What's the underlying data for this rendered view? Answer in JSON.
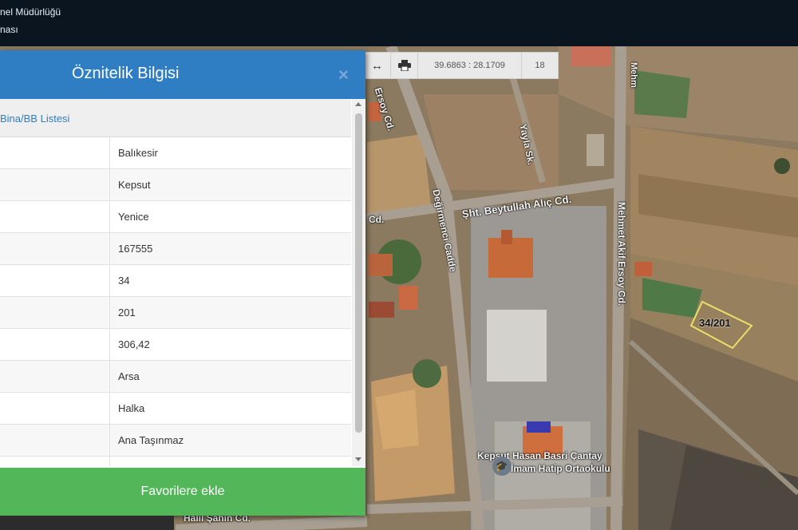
{
  "header": {
    "line1": "nel Müdürlüğü",
    "line2": "nası"
  },
  "toolbar": {
    "measure_icon": "arrows-horizontal-icon",
    "print_icon": "printer-icon",
    "coordinates": "39.6863 : 28.1709",
    "zoom_level": "18"
  },
  "map": {
    "street_labels": [
      "Ersoy Cd.",
      "Yayla Sk.",
      "Şht. Beytullah Alıç Cd.",
      "Değirmenci Cadde",
      "Mehmet Akif Ersoy Cd.",
      "Cd.",
      "Halil Şahin Cd.",
      "Kepsut Hasan Basri Çantay",
      "İmam Hatip Ortaokulu",
      "Mehm"
    ],
    "parcel_label": "34/201"
  },
  "panel": {
    "title": "Öznitelik Bilgisi",
    "close_symbol": "×",
    "section": "Bina/BB Listesi",
    "rows": [
      {
        "value": "Balıkesir"
      },
      {
        "value": "Kepsut"
      },
      {
        "value": "Yenice"
      },
      {
        "value": "167555"
      },
      {
        "value": "34"
      },
      {
        "value": "201"
      },
      {
        "value": "306,42"
      },
      {
        "value": "Arsa"
      },
      {
        "value": "Halka"
      },
      {
        "value": "Ana Taşınmaz"
      },
      {
        "value": ""
      }
    ],
    "favorite_button": "Favorilere ekle"
  },
  "colors": {
    "panel_header": "#2f7ec3",
    "favorite_button": "#53b75a",
    "parcel_outline": "#e8e06a"
  }
}
